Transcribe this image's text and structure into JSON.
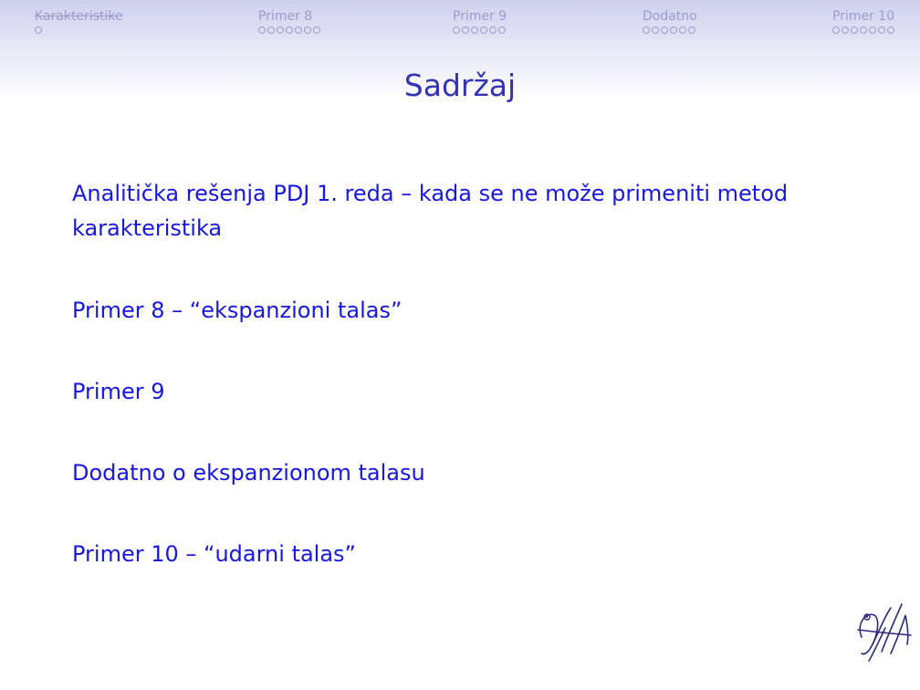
{
  "nav": {
    "sections": [
      {
        "label": "Karakteristike",
        "dots": 1,
        "current": false,
        "struck": true
      },
      {
        "label": "Primer 8",
        "dots": 7,
        "current": false,
        "struck": false
      },
      {
        "label": "Primer 9",
        "dots": 6,
        "current": false,
        "struck": false
      },
      {
        "label": "Dodatno",
        "dots": 6,
        "current": false,
        "struck": false
      },
      {
        "label": "Primer 10",
        "dots": 7,
        "current": false,
        "struck": false
      }
    ]
  },
  "frame": {
    "title": "Sadržaj"
  },
  "toc": {
    "items": [
      {
        "label": "Analitička rešenja PDJ 1. reda – kada se ne može primeniti metod karakteristika"
      },
      {
        "label": "Primer 8 – “ekspanzioni talas”"
      },
      {
        "label": "Primer 9"
      },
      {
        "label": "Dodatno o ekspanzionom talasu"
      },
      {
        "label": "Primer 10 – “udarni talas”"
      }
    ]
  },
  "colors": {
    "title": "#3333b3",
    "toc_text": "#1717e0",
    "nav_text": "#9c9ccc",
    "header_gradient_top": "#cfd0ee"
  },
  "logo": {
    "icon": "university-logo-icon"
  }
}
